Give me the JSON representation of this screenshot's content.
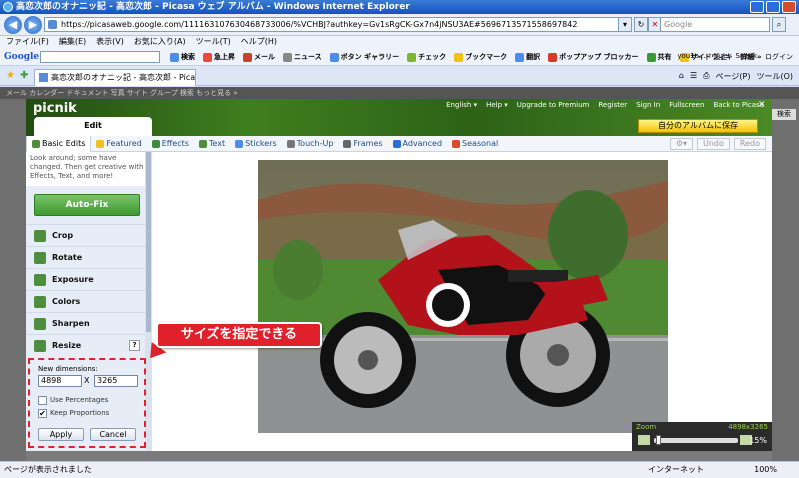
{
  "window": {
    "title": "高恋次郎のオナニッ記 - 高恋次郎 - Picasa ウェブ アルバム - Windows Internet Explorer"
  },
  "browser": {
    "address": "https://picasaweb.google.com/111163107630468733006/%VCHBJ?authkey=Gv1sRgCK-Gx7n4jNSU3AE#5696713571558697842",
    "search_placeholder": "Google",
    "menu": [
      "ファイル(F)",
      "編集(E)",
      "表示(V)",
      "お気に入り(A)",
      "ツール(T)",
      "ヘルプ(H)"
    ],
    "google_toolbar": {
      "logo": "Google",
      "search_label": "検索",
      "items": [
        "急上昇",
        "メール",
        "ニュース",
        "ボタン ギャラリー",
        "チェック",
        "ブックマーク",
        "翻訳",
        "ポップアップ ブロッカー",
        "共有",
        "サイドウィキ",
        "詳細 »"
      ],
      "right_items": [
        "you1o...",
        "設定",
        "Sneak",
        "ログイン"
      ]
    },
    "tab_title": "高恋次郎のオナニッ記 - 高恋次郎 - Picasa ウェブ ア...",
    "tab_right": [
      "ページ(P)",
      "ツール(O)"
    ],
    "status_left": "ページが表示されました",
    "status_zone": "インターネット",
    "status_zoom": "100%"
  },
  "picasa": {
    "strip": "メール カレンダー ドキュメント 写真 サイト グループ 検索 もっと見る »",
    "search_btn": "検索"
  },
  "picnik": {
    "logo": "picnik",
    "links": [
      "English ▾",
      "Help ▾",
      "Upgrade to Premium",
      "Register",
      "Sign In",
      "Fullscreen",
      "Back to Picasa"
    ],
    "save_button": "自分のアルバムに保存",
    "edit_tab": "Edit",
    "tabs": [
      "Basic Edits",
      "Featured",
      "Effects",
      "Text",
      "Stickers",
      "Touch-Up",
      "Frames",
      "Advanced",
      "Seasonal"
    ],
    "undo": "Undo",
    "redo": "Redo",
    "tip": "Look around; some have changed. Then get creative with Effects, Text, and more!",
    "autofix": "Auto-Fix",
    "tools": [
      "Crop",
      "Rotate",
      "Exposure",
      "Colors",
      "Sharpen",
      "Resize"
    ],
    "help": "?",
    "resize": {
      "label": "New dimensions:",
      "width": "4898",
      "x": "X",
      "height": "3265",
      "use_percentages": "Use Percentages",
      "keep_proportions": "Keep Proportions",
      "keep_checked": true,
      "apply": "Apply",
      "cancel": "Cancel"
    },
    "callout": "サイズを指定できる",
    "zoom": {
      "label": "Zoom",
      "size": "4898x3265",
      "percent": "15%"
    }
  },
  "colors": {
    "picnik_green": "#3f7e1e",
    "callout_red": "#e0202a",
    "save_yellow": "#f3c400",
    "ie_blue": "#1451c2"
  }
}
